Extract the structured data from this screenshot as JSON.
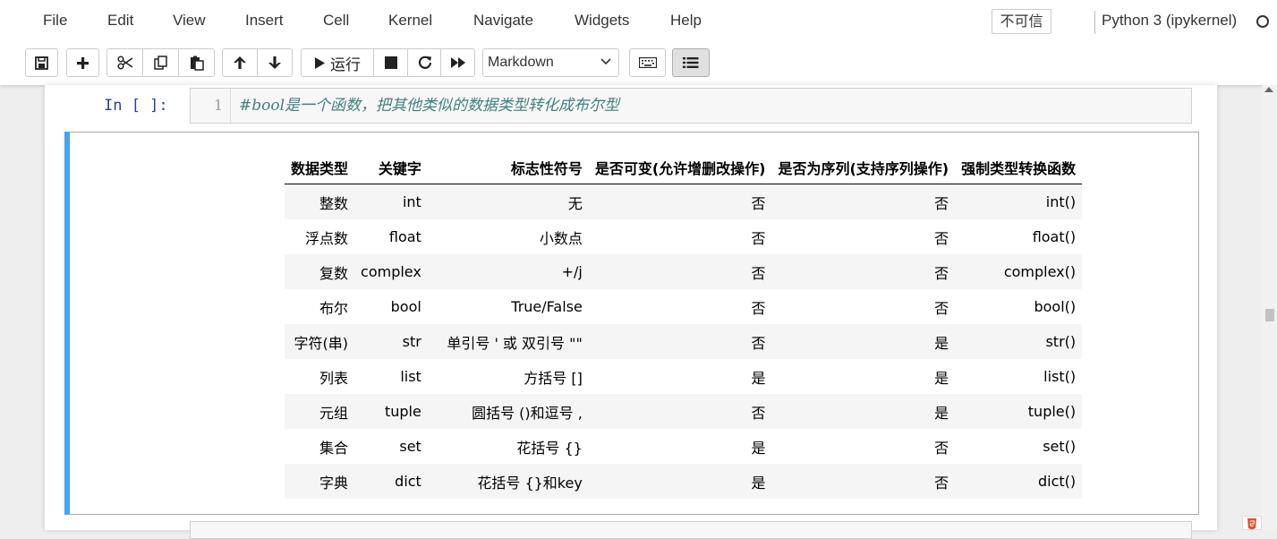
{
  "menubar": {
    "items": [
      "File",
      "Edit",
      "View",
      "Insert",
      "Cell",
      "Kernel",
      "Navigate",
      "Widgets",
      "Help"
    ],
    "trust_status": "不可信",
    "kernel_name": "Python 3 (ipykernel)"
  },
  "toolbar": {
    "run_label": "运行",
    "cell_type": "Markdown",
    "icons": [
      "save-icon",
      "plus-icon",
      "cut-icon",
      "copy-icon",
      "paste-icon",
      "arrow-up-icon",
      "arrow-down-icon",
      "play-icon",
      "stop-icon",
      "restart-icon",
      "fast-forward-icon",
      "keyboard-icon",
      "list-icon"
    ]
  },
  "code_cell": {
    "prompt": "In [ ]:",
    "line_number": "1",
    "code": "#bool是一个函数，把其他类似的数据类型转化成布尔型"
  },
  "table": {
    "headers": [
      "数据类型",
      "关键字",
      "标志性符号",
      "是否可变(允许增删改操作)",
      "是否为序列(支持序列操作)",
      "强制类型转换函数"
    ],
    "rows": [
      [
        "整数",
        "int",
        "无",
        "否",
        "否",
        "int()"
      ],
      [
        "浮点数",
        "float",
        "小数点",
        "否",
        "否",
        "float()"
      ],
      [
        "复数",
        "complex",
        "+/j",
        "否",
        "否",
        "complex()"
      ],
      [
        "布尔",
        "bool",
        "True/False",
        "否",
        "否",
        "bool()"
      ],
      [
        "字符(串)",
        "str",
        "单引号 ' 或 双引号 \"\"",
        "否",
        "是",
        "str()"
      ],
      [
        "列表",
        "list",
        "方括号 []",
        "是",
        "是",
        "list()"
      ],
      [
        "元组",
        "tuple",
        "圆括号 ()和逗号 ,",
        "否",
        "是",
        "tuple()"
      ],
      [
        "集合",
        "set",
        "花括号 {}",
        "是",
        "否",
        "set()"
      ],
      [
        "字典",
        "dict",
        "花括号 {}和key",
        "是",
        "否",
        "dict()"
      ]
    ]
  },
  "colors": {
    "selected_cell_border": "#42a5f5",
    "prompt": "#303f9f",
    "comment": "#408080"
  }
}
